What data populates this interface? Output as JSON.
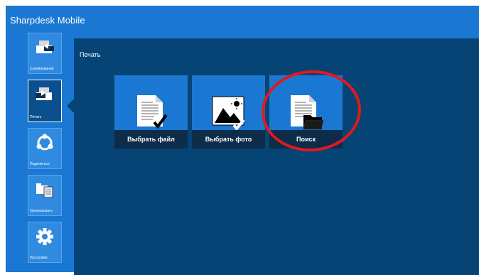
{
  "app": {
    "title": "Sharpdesk Mobile"
  },
  "colors": {
    "title_bar": "#1a78d2",
    "content_bg": "#064475",
    "tile_bg": "#1a78d2",
    "tile_label_bg": "#0d2c4a",
    "annotation": "#e0191e"
  },
  "sidebar": {
    "items": [
      {
        "label": "Сканирование",
        "icon": "scan-icon",
        "active": false
      },
      {
        "label": "Печать",
        "icon": "print-icon",
        "active": true
      },
      {
        "label": "Поделиться",
        "icon": "share-icon",
        "active": false
      },
      {
        "label": "Организовать",
        "icon": "organize-icon",
        "active": false
      },
      {
        "label": "Настройки",
        "icon": "gear-icon",
        "active": false
      }
    ]
  },
  "main": {
    "section_title": "Печать",
    "tiles": [
      {
        "label": "Выбрать файл",
        "icon": "document-check-icon"
      },
      {
        "label": "Выбрать фото",
        "icon": "photo-check-icon"
      },
      {
        "label": "Поиск",
        "icon": "document-folder-icon"
      }
    ]
  }
}
